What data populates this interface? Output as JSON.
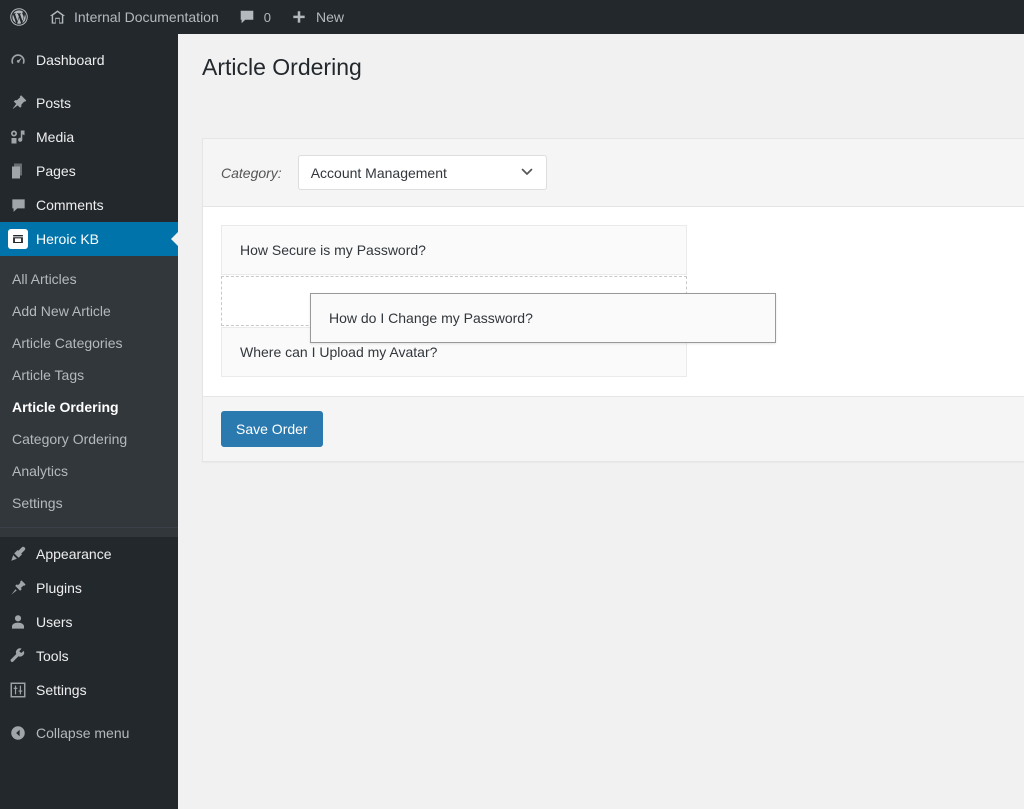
{
  "adminbar": {
    "wp_logo": "wordpress-logo-icon",
    "site_name": "Internal Documentation",
    "site_icon": "home-icon",
    "comments_icon": "comment-bubble-icon",
    "comments_count": "0",
    "new_icon": "plus-icon",
    "new_label": "New"
  },
  "sidebar": {
    "top_items": [
      {
        "label": "Dashboard",
        "icon": "dashboard-icon",
        "name": "dashboard"
      },
      {
        "label": "Posts",
        "icon": "pin-icon",
        "name": "posts"
      },
      {
        "label": "Media",
        "icon": "media-icon",
        "name": "media"
      },
      {
        "label": "Pages",
        "icon": "pages-icon",
        "name": "pages"
      },
      {
        "label": "Comments",
        "icon": "comment-bubble-icon",
        "name": "comments"
      },
      {
        "label": "Heroic KB",
        "icon": "heroic-kb-icon",
        "name": "heroic-kb",
        "current": true
      }
    ],
    "submenu": [
      {
        "label": "All Articles",
        "name": "all-articles"
      },
      {
        "label": "Add New Article",
        "name": "add-new-article"
      },
      {
        "label": "Article Categories",
        "name": "article-categories"
      },
      {
        "label": "Article Tags",
        "name": "article-tags"
      },
      {
        "label": "Article Ordering",
        "name": "article-ordering",
        "current": true
      },
      {
        "label": "Category Ordering",
        "name": "category-ordering"
      },
      {
        "label": "Analytics",
        "name": "analytics"
      },
      {
        "label": "Settings",
        "name": "settings"
      }
    ],
    "bottom_items": [
      {
        "label": "Appearance",
        "icon": "appearance-brush-icon",
        "name": "appearance"
      },
      {
        "label": "Plugins",
        "icon": "plug-icon",
        "name": "plugins"
      },
      {
        "label": "Users",
        "icon": "user-icon",
        "name": "users"
      },
      {
        "label": "Tools",
        "icon": "wrench-icon",
        "name": "tools"
      },
      {
        "label": "Settings",
        "icon": "sliders-icon",
        "name": "settings"
      }
    ],
    "collapse": {
      "label": "Collapse menu",
      "icon": "collapse-arrow-icon"
    }
  },
  "main": {
    "page_title": "Article Ordering",
    "category_label": "Category:",
    "category_value": "Account Management",
    "category_caret": "chevron-down-icon",
    "articles": [
      {
        "label": "How Secure is my Password?",
        "state": "normal"
      },
      {
        "label": "",
        "state": "placeholder"
      },
      {
        "label": "Where can I Upload my Avatar?",
        "state": "normal"
      }
    ],
    "dragged_article": "How do I Change my Password?",
    "save_label": "Save Order"
  },
  "colors": {
    "admin_bar": "#23282d",
    "sidebar": "#23282d",
    "submenu": "#32373c",
    "accent_blue": "#0073aa",
    "button_blue": "#2a7ab0",
    "page_bg": "#f1f1f1",
    "card_bg": "#ffffff",
    "card_section_bg": "#f5f5f5"
  }
}
